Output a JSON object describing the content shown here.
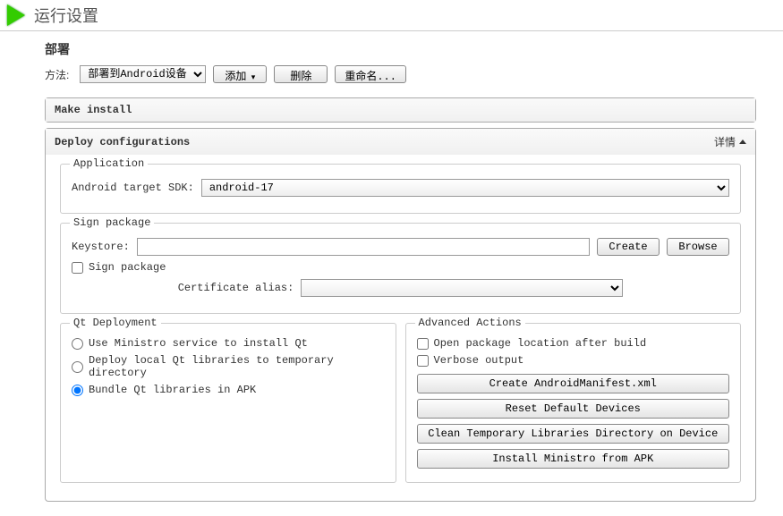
{
  "header": {
    "title": "运行设置"
  },
  "deploy": {
    "section_title": "部署",
    "method_label": "方法:",
    "method_selected": "部署到Android设备",
    "add_label": "添加",
    "delete_label": "删除",
    "rename_label": "重命名..."
  },
  "make_install": {
    "title": "Make install"
  },
  "deploy_config": {
    "title": "Deploy configurations",
    "details_label": "详情"
  },
  "application": {
    "legend": "Application",
    "target_sdk_label": "Android target SDK:",
    "target_sdk_value": "android-17"
  },
  "sign_package": {
    "legend": "Sign package",
    "keystore_label": "Keystore:",
    "keystore_value": "",
    "create_label": "Create",
    "browse_label": "Browse",
    "sign_checkbox_label": "Sign package",
    "cert_alias_label": "Certificate alias:",
    "cert_alias_value": ""
  },
  "qt_deployment": {
    "legend": "Qt Deployment",
    "opt_ministro": "Use Ministro service to install Qt",
    "opt_local": "Deploy local Qt libraries to temporary directory",
    "opt_bundle": "Bundle Qt libraries in APK"
  },
  "advanced": {
    "legend": "Advanced Actions",
    "open_pkg_label": "Open package location after build",
    "verbose_label": "Verbose output",
    "btn_manifest": "Create AndroidManifest.xml",
    "btn_reset": "Reset Default Devices",
    "btn_clean": "Clean Temporary Libraries Directory on Device",
    "btn_install": "Install Ministro from APK"
  }
}
